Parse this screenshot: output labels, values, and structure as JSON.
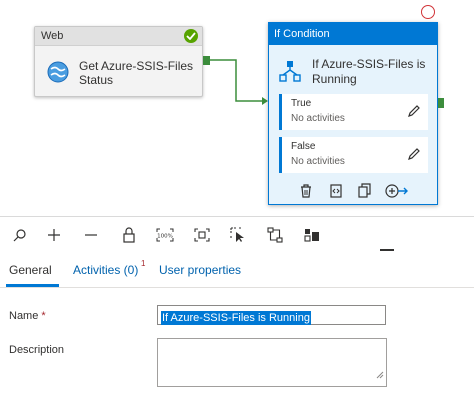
{
  "web_activity": {
    "type_label": "Web",
    "title": "Get Azure-SSIS-Files Status",
    "status_icon": "success-check-icon",
    "icon": "globe-icon"
  },
  "if_activity": {
    "type_label": "If Condition",
    "title": "If Azure-SSIS-Files is Running",
    "icon": "if-condition-icon",
    "true_branch": {
      "label": "True",
      "sub": "No activities"
    },
    "false_branch": {
      "label": "False",
      "sub": "No activities"
    },
    "toolbar_icons": [
      "delete-icon",
      "code-icon",
      "copy-icon",
      "add-output-icon"
    ]
  },
  "canvas_toolbar": {
    "icons": [
      "search-icon",
      "zoom-in-icon",
      "zoom-out-icon",
      "lock-icon",
      "zoom-100-icon",
      "fit-to-window-icon",
      "select-icon",
      "auto-align-icon",
      "layout-icon"
    ]
  },
  "tabs": {
    "general": "General",
    "activities": "Activities (0)",
    "activities_badge": "1",
    "user_properties": "User properties"
  },
  "form": {
    "name_label": "Name",
    "required_marker": "*",
    "name_value": "If Azure-SSIS-Files is Running",
    "description_label": "Description",
    "description_value": ""
  },
  "colors": {
    "accent": "#0078d4",
    "success": "#57a300",
    "port": "#3c8d3c",
    "alert": "#d13438"
  }
}
